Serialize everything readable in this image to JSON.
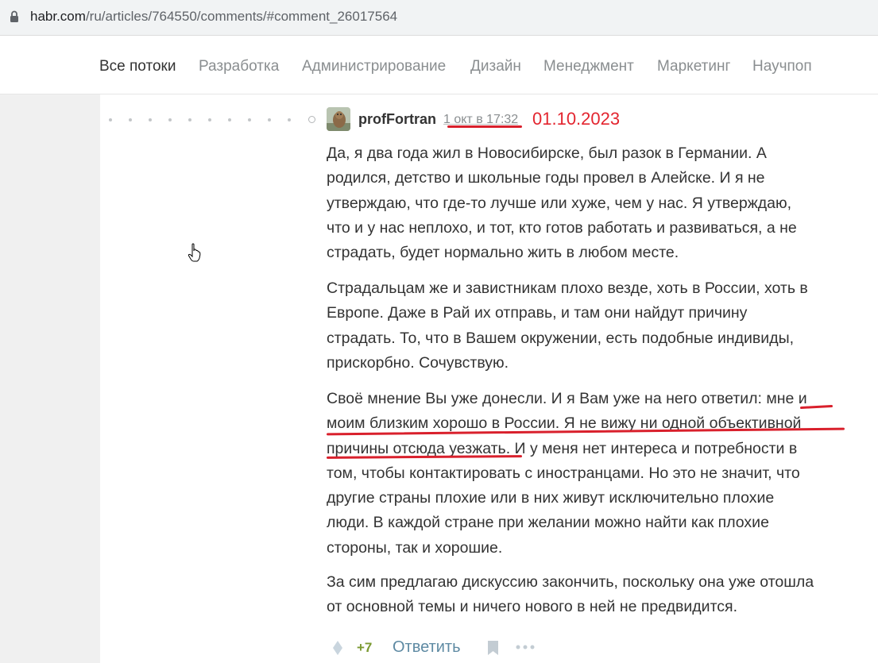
{
  "browser": {
    "url_host": "habr.com",
    "url_path": "/ru/articles/764550/comments/#comment_26017564"
  },
  "nav": {
    "items": [
      {
        "label": "Все потоки",
        "active": true
      },
      {
        "label": "Разработка",
        "active": false
      },
      {
        "label": "Администрирование",
        "active": false
      },
      {
        "label": "Дизайн",
        "active": false
      },
      {
        "label": "Менеджмент",
        "active": false
      },
      {
        "label": "Маркетинг",
        "active": false
      },
      {
        "label": "Научпоп",
        "active": false
      }
    ]
  },
  "comment": {
    "author": "profFortran",
    "timestamp": "1 окт в 17:32",
    "annotation_date": "01.10.2023",
    "paragraphs": [
      [
        "Да, я два года жил в Новосибирске, был разок в Германии. А",
        "родился, детство и школьные годы провел в Алейске. И я не",
        "утверждаю, что где-то лучше или хуже, чем у нас. Я утверждаю,",
        "что и у нас неплохо, и тот, кто готов работать и развиваться, а не",
        "страдать, будет нормально жить в любом месте."
      ],
      [
        "Страдальцам же и завистникам плохо везде, хоть в России, хоть в",
        "Европе. Даже в Рай их отправь, и там они найдут причину",
        "страдать. То, что в Вашем окружении, есть подобные индивиды,",
        "прискорбно. Сочувствую."
      ],
      [
        "Своё мнение Вы уже донесли. И я Вам уже на него ответил: мне и",
        "моим близким хорошо в России. Я не вижу ни одной объективной",
        "причины отсюда уезжать. И у меня нет интереса и потребности в",
        "том, чтобы контактировать с иностранцами. Но это не значит, что",
        "другие страны плохие или в них живут исключительно плохие",
        "люди. В каждой стране при желании можно найти как плохие",
        "стороны, так и хорошие."
      ],
      [
        "За сим предлагаю дискуссию закончить, поскольку она уже отошла",
        "от основной темы и ничего нового в ней не предвидится."
      ]
    ],
    "score": "+7",
    "reply_label": "Ответить"
  },
  "icons": {
    "lock": "lock-icon",
    "vote": "vote-diamond-icon",
    "bookmark": "bookmark-icon",
    "more": "more-dots-icon",
    "cursor": "hand-pointer-icon"
  },
  "colors": {
    "accent_link": "#5e8aa3",
    "score_positive": "#7b9a32",
    "annotation_red": "#e3252f"
  }
}
